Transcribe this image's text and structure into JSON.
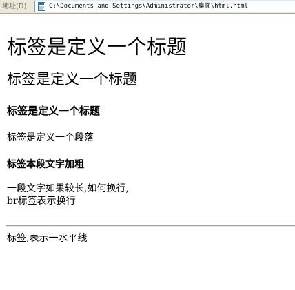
{
  "address_bar": {
    "label": "地址(D)",
    "url": "C:\\Documents and Settings\\Administrator\\桌面\\html.html",
    "page_icon": "document-icon"
  },
  "document": {
    "h1": "标签是定义一个标题",
    "h2": "标签是定义一个标题",
    "h3": "标签是定义一个标题",
    "paragraph": "标签是定义一个段落",
    "bold_text": "标签本段文字加粗",
    "long_text_line1": "一段文字如果较长,如何换行,",
    "long_text_line2": "br标签表示换行",
    "hr_caption": "标签,表示一水平线"
  }
}
